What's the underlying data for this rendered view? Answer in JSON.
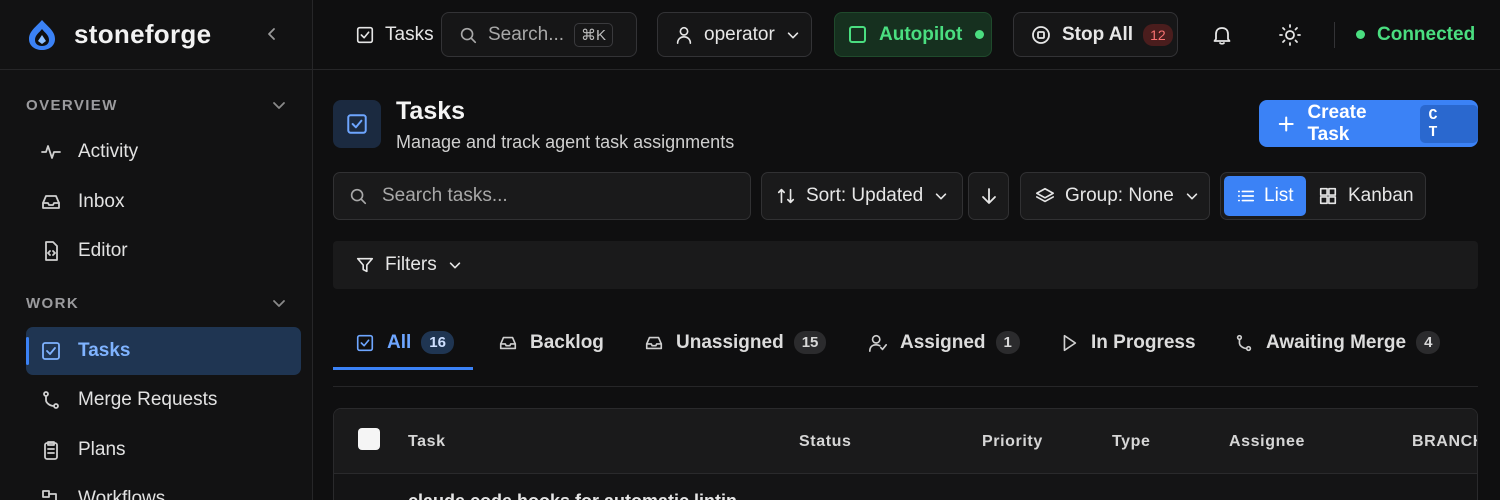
{
  "brand": {
    "name": "stoneforge"
  },
  "sidebar": {
    "sections": [
      {
        "title": "OVERVIEW",
        "items": [
          {
            "label": "Activity",
            "icon": "activity-icon"
          },
          {
            "label": "Inbox",
            "icon": "inbox-icon"
          },
          {
            "label": "Editor",
            "icon": "editor-icon"
          }
        ]
      },
      {
        "title": "WORK",
        "items": [
          {
            "label": "Tasks",
            "icon": "tasks-icon",
            "active": true
          },
          {
            "label": "Merge Requests",
            "icon": "merge-icon"
          },
          {
            "label": "Plans",
            "icon": "plans-icon"
          },
          {
            "label": "Workflows",
            "icon": "workflows-icon"
          }
        ]
      }
    ]
  },
  "topbar": {
    "breadcrumb": "Tasks",
    "search_placeholder": "Search...",
    "search_shortcut": "⌘K",
    "user": "operator",
    "autopilot": "Autopilot",
    "stop_all": "Stop All",
    "stop_all_count": "12",
    "status": "Connected"
  },
  "page": {
    "title": "Tasks",
    "subtitle": "Manage and track agent task assignments",
    "create_label": "Create Task",
    "create_shortcut": "C T"
  },
  "controls": {
    "search_placeholder": "Search tasks...",
    "sort": "Sort: Updated",
    "group": "Group: None",
    "view_list": "List",
    "view_kanban": "Kanban",
    "filters": "Filters"
  },
  "tabs": [
    {
      "label": "All",
      "count": "16",
      "active": true
    },
    {
      "label": "Backlog",
      "count": ""
    },
    {
      "label": "Unassigned",
      "count": "15"
    },
    {
      "label": "Assigned",
      "count": "1"
    },
    {
      "label": "In Progress",
      "count": ""
    },
    {
      "label": "Awaiting Merge",
      "count": "4"
    }
  ],
  "table": {
    "columns": [
      "Task",
      "Status",
      "Priority",
      "Type",
      "Assignee",
      "BRANCH"
    ],
    "rows": [
      {
        "task": "claude code hooks for automatic lintin"
      }
    ]
  },
  "colors": {
    "accent": "#3b82f6",
    "connected": "#4ade80",
    "autopilot": "#4ade80",
    "stop_badge": "#f87171"
  }
}
